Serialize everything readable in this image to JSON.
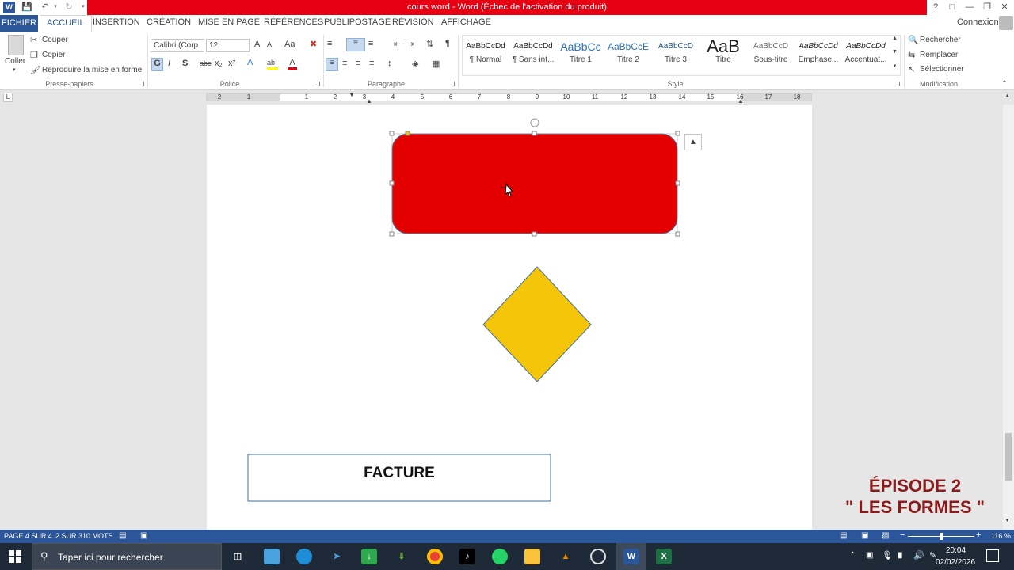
{
  "window": {
    "title": "cours word - Word (Échec de l'activation du produit)",
    "help": "?",
    "sign_in": "Connexion"
  },
  "tabs": {
    "file": "FICHIER",
    "items": [
      "ACCUEIL",
      "INSERTION",
      "CRÉATION",
      "MISE EN PAGE",
      "RÉFÉRENCES",
      "PUBLIPOSTAGE",
      "RÉVISION",
      "AFFICHAGE"
    ]
  },
  "clipboard": {
    "paste": "Coller",
    "cut": "Couper",
    "copy": "Copier",
    "format_painter": "Reproduire la mise en forme",
    "label": "Presse-papiers"
  },
  "font": {
    "name": "Calibri (Corp",
    "size": "12",
    "bold": "G",
    "italic": "I",
    "underline": "S",
    "strike": "abc",
    "sub": "x₂",
    "sup": "x²",
    "change_case": "Aa",
    "grow": "A",
    "shrink": "A",
    "font_color": "A",
    "text_effects": "A",
    "label": "Police"
  },
  "paragraph": {
    "label": "Paragraphe",
    "pilcrow": "¶"
  },
  "styles": {
    "label": "Style",
    "items": [
      {
        "preview": "AaBbCcDd",
        "name": "¶ Normal"
      },
      {
        "preview": "AaBbCcDd",
        "name": "¶ Sans int..."
      },
      {
        "preview": "AaBbCc",
        "name": "Titre 1"
      },
      {
        "preview": "AaBbCcE",
        "name": "Titre 2"
      },
      {
        "preview": "AaBbCcD",
        "name": "Titre 3"
      },
      {
        "preview": "AaB",
        "name": "Titre"
      },
      {
        "preview": "AaBbCcD",
        "name": "Sous-titre"
      },
      {
        "preview": "AaBbCcDd",
        "name": "Emphase..."
      },
      {
        "preview": "AaBbCcDd",
        "name": "Accentuat..."
      }
    ]
  },
  "editing": {
    "label": "Modification",
    "find": "Rechercher",
    "replace": "Remplacer",
    "select": "Sélectionner"
  },
  "ruler": {
    "numbers": [
      "2",
      "1",
      "1",
      "2",
      "3",
      "4",
      "5",
      "6",
      "7",
      "8",
      "9",
      "10",
      "11",
      "12",
      "13",
      "14",
      "15",
      "16",
      "17",
      "18"
    ]
  },
  "document": {
    "invoice_text": "FACTURE"
  },
  "colors": {
    "accent": "#2b579a",
    "title_red": "#e60012",
    "rect_fill": "#e50000",
    "diamond_fill": "#f5c50a",
    "shape_outline": "#41719c"
  },
  "overlay": {
    "line1": "ÉPISODE 2",
    "line2": "\" LES FORMES \""
  },
  "status": {
    "page": "PAGE 4 SUR 4",
    "words": "2 SUR 310 MOTS",
    "zoom": "116 %"
  },
  "taskbar": {
    "search_placeholder": "Taper ici pour rechercher",
    "time": "20:04",
    "date": "02/02/2026"
  }
}
